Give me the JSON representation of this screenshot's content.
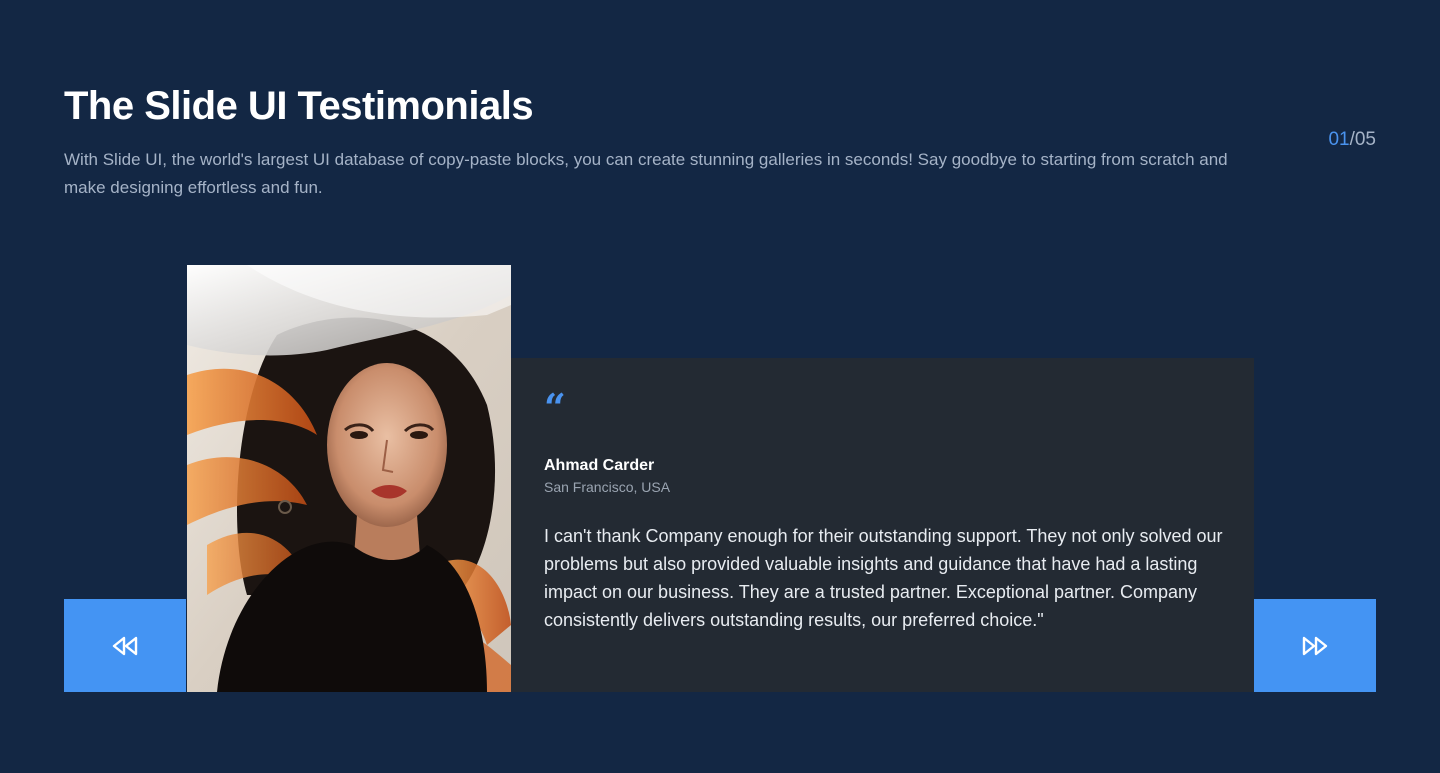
{
  "header": {
    "title": "The Slide UI Testimonials",
    "subtitle": "With Slide UI, the world's largest UI database of copy-paste blocks, you can create stunning galleries in seconds! Say goodbye to starting from scratch and make designing effortless and fun."
  },
  "pagination": {
    "current": "01",
    "separator": "/",
    "total": "05"
  },
  "controls": {
    "prev_icon": "rewind-icon",
    "next_icon": "fast-forward-icon"
  },
  "testimonial": {
    "quote_glyph": "“",
    "author_name": "Ahmad Carder",
    "author_location": "San Francisco, USA",
    "text": "I can't thank Company enough for their outstanding support. They not only solved our problems but also provided valuable insights and guidance that have had a lasting impact on our business. They are a trusted partner. Exceptional partner. Company consistently delivers outstanding results, our preferred choice.\""
  },
  "colors": {
    "background": "#132744",
    "accent": "#4494f3",
    "card": "#232a33",
    "muted_text": "#a5b3c7"
  }
}
